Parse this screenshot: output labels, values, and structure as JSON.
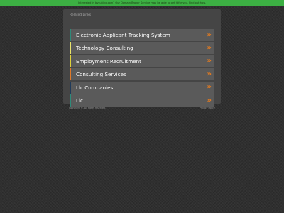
{
  "banner": {
    "text": "Interested in bvsuiting.com? Our Domain Broker Service may be able to get it for you. Find out how.",
    "color": "#3cb043"
  },
  "panel": {
    "title": "Related Links",
    "links": [
      {
        "label": "Electronic Applicant Tracking System",
        "accent": "#2e8b7a"
      },
      {
        "label": "Technology Consulting",
        "accent": "#e9e36a"
      },
      {
        "label": "Employment Recruitment",
        "accent": "#dfd23a"
      },
      {
        "label": "Consulting Services",
        "accent": "#e07a2a"
      },
      {
        "label": "Llc Companies",
        "accent": "#1f3a5a"
      },
      {
        "label": "Llc",
        "accent": "#2e8b7a"
      }
    ],
    "arrow_glyph": "»",
    "arrow_icon": "double-chevron-right-icon",
    "arrow_color": "#e87c1e"
  },
  "footer": {
    "copyright": "Copyright ©. All rights reserved.",
    "privacy": "Privacy Policy"
  }
}
